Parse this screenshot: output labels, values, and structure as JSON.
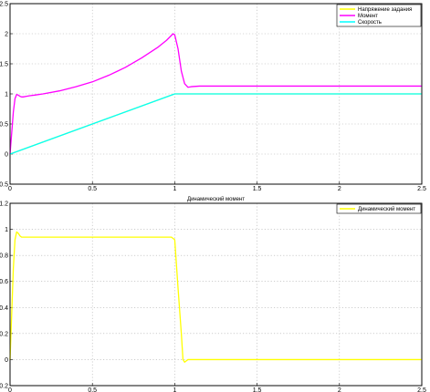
{
  "chart_data": [
    {
      "type": "line",
      "title": "",
      "xlabel": "",
      "ylabel": "",
      "xlim": [
        0,
        2.5
      ],
      "ylim": [
        -0.5,
        2.5
      ],
      "xticks": [
        "0",
        "0.5",
        "1",
        "1.5",
        "2",
        "2.5"
      ],
      "yticks": [
        "-0.5",
        "0",
        "0.5",
        "1",
        "1.5",
        "2",
        "2.5"
      ],
      "grid": true,
      "legend_position": "top-right",
      "series": [
        {
          "name": "Напряжение задания",
          "color": "#ffff00",
          "x": [
            0,
            1.0,
            2.5
          ],
          "y": [
            0,
            1.0,
            1.0
          ]
        },
        {
          "name": "Момент",
          "color": "#ff00ff",
          "x": [
            0,
            0.01,
            0.02,
            0.03,
            0.04,
            0.05,
            0.06,
            0.07,
            0.08,
            0.1,
            0.12,
            0.15,
            0.2,
            0.3,
            0.4,
            0.5,
            0.6,
            0.7,
            0.8,
            0.9,
            0.95,
            0.99,
            1.0,
            1.02,
            1.04,
            1.06,
            1.08,
            1.1,
            1.15,
            1.2,
            2.5
          ],
          "y": [
            0,
            0.35,
            0.7,
            0.92,
            0.99,
            0.98,
            0.96,
            0.95,
            0.95,
            0.96,
            0.97,
            0.98,
            1.0,
            1.05,
            1.12,
            1.2,
            1.31,
            1.44,
            1.6,
            1.78,
            1.89,
            2.0,
            1.98,
            1.75,
            1.38,
            1.17,
            1.11,
            1.12,
            1.13,
            1.13,
            1.13
          ]
        },
        {
          "name": "Скорость",
          "color": "#00ffff",
          "x": [
            0,
            1.0,
            2.5
          ],
          "y": [
            0,
            1.0,
            1.0
          ]
        }
      ]
    },
    {
      "type": "line",
      "title": "Динамический момент",
      "xlabel": "",
      "ylabel": "",
      "xlim": [
        0,
        2.5
      ],
      "ylim": [
        -0.2,
        1.2
      ],
      "xticks": [
        "0",
        "0.5",
        "1",
        "1.5",
        "2",
        "2.5"
      ],
      "yticks": [
        "-0.2",
        "0",
        "0.2",
        "0.4",
        "0.6",
        "0.8",
        "1",
        "1.2"
      ],
      "grid": true,
      "legend_position": "top-right",
      "series": [
        {
          "name": "Динамический момент",
          "color": "#ffff00",
          "x": [
            0,
            0.01,
            0.02,
            0.03,
            0.04,
            0.05,
            0.06,
            0.07,
            0.08,
            0.1,
            0.5,
            0.98,
            1.0,
            1.02,
            1.04,
            1.05,
            1.06,
            1.07,
            1.08,
            1.1,
            1.15,
            2.5
          ],
          "y": [
            0,
            0.35,
            0.7,
            0.92,
            0.98,
            0.97,
            0.95,
            0.94,
            0.94,
            0.94,
            0.94,
            0.94,
            0.92,
            0.55,
            0.2,
            0.0,
            -0.02,
            -0.01,
            0.0,
            0.0,
            0.0,
            0.0
          ]
        }
      ]
    }
  ]
}
